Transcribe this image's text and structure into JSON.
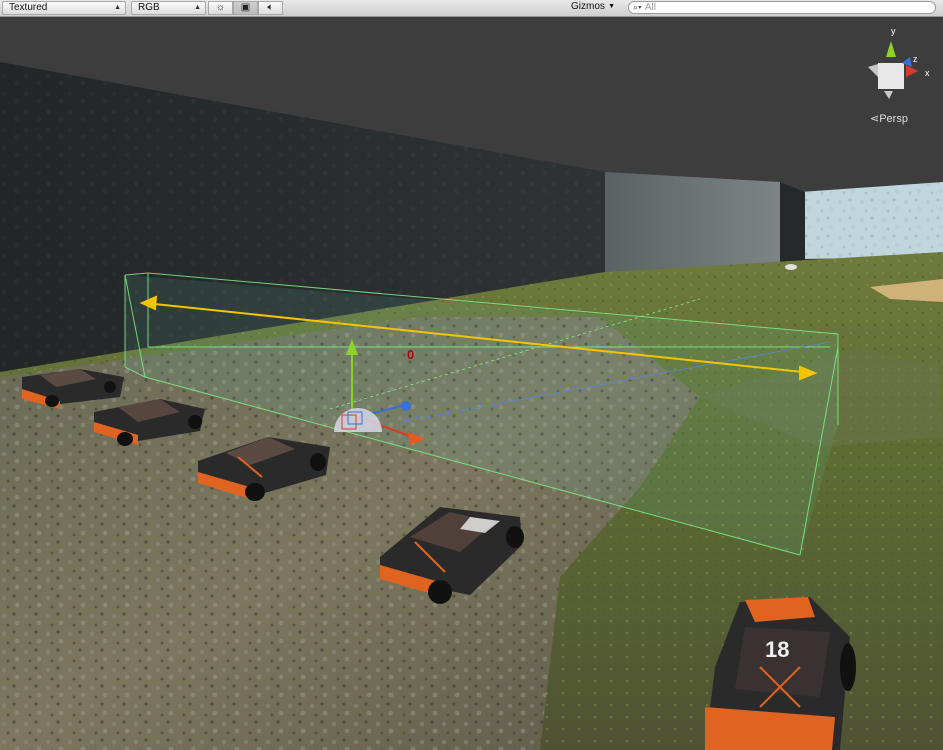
{
  "toolbar": {
    "render_mode": "Textured",
    "color_mode": "RGB",
    "lighting_icon": "sun-icon",
    "image_icon": "image-icon",
    "audio_icon": "speaker-icon",
    "gizmos_label": "Gizmos",
    "search_placeholder": "All"
  },
  "orientation_gizmo": {
    "axes": [
      "y",
      "z",
      "x"
    ],
    "projection": "Persp",
    "colors": {
      "x": "#d83a2a",
      "y": "#8ed12a",
      "z": "#3a6fd8"
    }
  },
  "scene": {
    "pivot_label": "0",
    "car_numbers": [
      "18"
    ],
    "colors": {
      "sky": "#3d3d3d",
      "wall": "#2a2d2e",
      "ground": "#55662e",
      "trigger_box": "#7cf08a",
      "direction_arrow": "#f5c400"
    }
  }
}
